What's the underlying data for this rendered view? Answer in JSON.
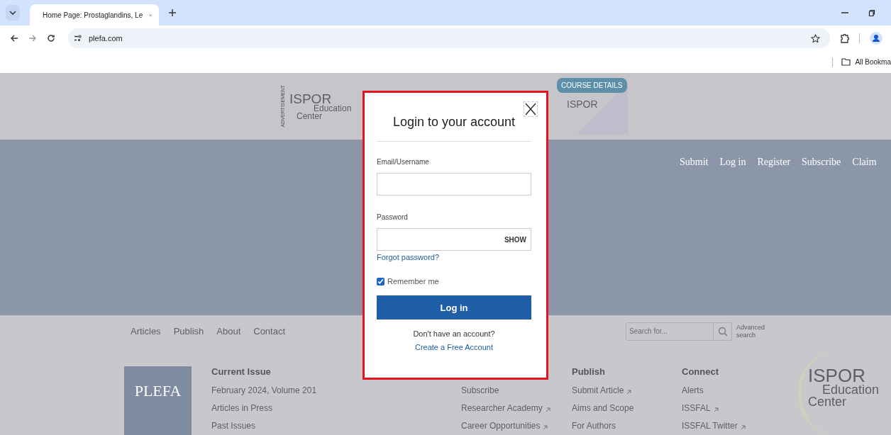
{
  "browser": {
    "tab_title": "Home Page: Prostaglandins, Le",
    "url": "plefa.com",
    "bookmarks_label": "All Bookma"
  },
  "ad": {
    "vertical_label": "ADVERTISEMENT",
    "logo_lines": [
      "ISPOR",
      "Education",
      "Center"
    ],
    "cta": "COURSE DETAILS",
    "brand": "ISPOR"
  },
  "top_nav": [
    "Submit",
    "Log in",
    "Register",
    "Subscribe",
    "Claim"
  ],
  "footer_nav": [
    "Articles",
    "Publish",
    "About",
    "Contact"
  ],
  "search": {
    "placeholder": "Search for...",
    "advanced": "Advanced search"
  },
  "cover": {
    "title": "PLEFA"
  },
  "columns": [
    {
      "heading": "Current Issue",
      "links": [
        {
          "label": "February 2024, Volume 201",
          "external": false
        },
        {
          "label": "Articles in Press",
          "external": false
        },
        {
          "label": "Past Issues",
          "external": false
        }
      ]
    },
    {
      "links": [
        {
          "label": "Subscribe",
          "external": false
        },
        {
          "label": "Researcher Academy",
          "external": true
        },
        {
          "label": "Career Opportunities",
          "external": true
        }
      ]
    },
    {
      "heading": "Publish",
      "links": [
        {
          "label": "Submit Article",
          "external": true
        },
        {
          "label": "Aims and Scope",
          "external": false
        },
        {
          "label": "For Authors",
          "external": false
        }
      ]
    },
    {
      "heading": "Connect",
      "links": [
        {
          "label": "Alerts",
          "external": false
        },
        {
          "label": "ISSFAL",
          "external": true
        },
        {
          "label": "ISSFAL Twitter",
          "external": true
        }
      ]
    }
  ],
  "footer_logo": [
    "ISPOR",
    "Education",
    "Center"
  ],
  "modal": {
    "title": "Login to your account",
    "email_label": "Email/Username",
    "password_label": "Password",
    "show": "SHOW",
    "forgot": "Forgot password?",
    "remember": {
      "label": "Remember me",
      "checked": true
    },
    "submit": "Log in",
    "no_account": "Don't have an account?",
    "create": "Create a Free Account"
  }
}
